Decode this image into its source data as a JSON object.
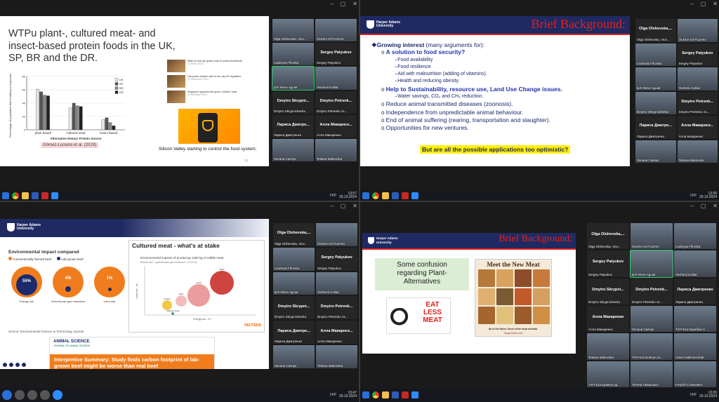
{
  "q1": {
    "slide_title": "WTPu plant-, cultured meat- and insect-based protein foods in the UK, SP, BR and the DR.",
    "chart_ylabel": "Percentage of population that is willing to buy/consume",
    "chart_xlabel": "Alternative Dietary Protein Source",
    "citation": "Gómez-Luciano et al. (2019)",
    "caption": "Silicon Valley starting to control the food system;",
    "page": "13",
    "news": [
      {
        "t": "Rally for how lab grown meat to protect livelihoods",
        "d": "14 March 2023"
      },
      {
        "t": "Lab grown chicken safe to eat, say US regulators",
        "d": "17 November 2022"
      },
      {
        "t": "Singapore approves lab grown 'chicken' meat",
        "d": "2 December 2020"
      }
    ],
    "chart_data": {
      "type": "bar",
      "categories": [
        "plant based",
        "cultured meat",
        "insect based"
      ],
      "series": [
        {
          "name": "UK",
          "values": [
            61,
            33,
            15
          ]
        },
        {
          "name": "SP",
          "values": [
            57,
            40,
            18
          ]
        },
        {
          "name": "BR",
          "values": [
            52,
            36,
            11
          ]
        },
        {
          "name": "DR",
          "values": [
            51,
            35,
            6
          ]
        }
      ],
      "ylim": [
        0,
        80
      ],
      "yticks": [
        "0",
        "20",
        "40",
        "60",
        "80"
      ]
    },
    "participants": [
      {
        "name": "Olga Olshevska, Vice...",
        "active": false
      },
      {
        "name": "OLENA KOTUZAKI",
        "active": false
      },
      {
        "name": "Liudmyla Fifurska",
        "active": false
      },
      {
        "name": "Sergey Patyukov",
        "active": false,
        "big": "Sergey Patyukov"
      },
      {
        "name": "Ijeh Kleve Aguiar",
        "active": true
      },
      {
        "name": "Yevhenii Kotliar",
        "active": false
      },
      {
        "name": "Dmytro Skrypnichenko",
        "active": false,
        "big": "Dmytro Skrypni..."
      },
      {
        "name": "Dmytro Petrenko 41...",
        "active": false,
        "big": "Dmytro Petrenk..."
      },
      {
        "name": "Лариса Дмитренко",
        "active": false,
        "big": "Лариса Дмитре..."
      },
      {
        "name": "Алла Макаренко",
        "active": false,
        "big": "Алла Макарнск..."
      },
      {
        "name": "Оксана Савчук",
        "active": false
      },
      {
        "name": "Tetiana Makovska",
        "active": false
      }
    ],
    "time": "13:57",
    "date": "29.10.2024",
    "lang": "УКР"
  },
  "q2": {
    "title": "Brief Background:",
    "uni": "Harper Adams University",
    "bullets": [
      {
        "lvl": 0,
        "text": "❖Growing interest",
        "rest": " (many arguments for):",
        "bold": true,
        "color": "#1b2a6b"
      },
      {
        "lvl": 1,
        "text": "A solution to food security?",
        "bold": true,
        "color": "#2233aa"
      },
      {
        "lvl": 2,
        "text": "Food availability"
      },
      {
        "lvl": 2,
        "text": "Food resilience"
      },
      {
        "lvl": 2,
        "text": "Aid with malnutrition (adding of vitamins)."
      },
      {
        "lvl": 2,
        "text": "Health and reducing obesity."
      },
      {
        "lvl": 1,
        "text": "Help to Sustainability, resource use, Land Use Change issues.",
        "bold": true,
        "color": "#2233aa"
      },
      {
        "lvl": 2,
        "text": "Water savings,  CO₂ and CH₄ reduction."
      },
      {
        "lvl": 1,
        "text": "Reduce animal transmitted diseases (zoonosis)."
      },
      {
        "lvl": 1,
        "text": "Independence from unpredictable animal behaviour."
      },
      {
        "lvl": 1,
        "text": "End of animal suffering (rearing, transportation and slaughter).",
        "boldpart": "End of animal suffering"
      },
      {
        "lvl": 1,
        "text": "Opportunities for new ventures."
      }
    ],
    "highlight": "But are all the possible applications too optimistic?",
    "participants": [
      {
        "name": "Olga Olshevska, Vice...",
        "big": "Olga Olshevska,..."
      },
      {
        "name": "OLENA KOTUZAKI"
      },
      {
        "name": "Liudmyla Fifurska"
      },
      {
        "name": "Sergey Patyukov",
        "big": "Sergey Patyukov"
      },
      {
        "name": "Ijeh Kleve Aguiar"
      },
      {
        "name": "Yevhenii Kotliar"
      },
      {
        "name": "Dmytro Skrypnichenko"
      },
      {
        "name": "Dmytro Petrenko 41...",
        "big": "Dmytro Petrenk..."
      },
      {
        "name": "Лариса Дмитренко",
        "big": "Лариса Дмитре..."
      },
      {
        "name": "Алла Макаренко",
        "big": "Алла Макарнск..."
      },
      {
        "name": "Оксана Савчук"
      },
      {
        "name": "Tetiana Makovska"
      }
    ],
    "time": "13:26",
    "date": "29.10.2024",
    "lang": "УКР"
  },
  "q3": {
    "uni": "Harper Adams University",
    "env_title": "Environmental impact compared",
    "legend": [
      "Conventionally farmed beef",
      "Lab-grown beef"
    ],
    "circles": [
      {
        "pct": "55%",
        "label": "Energy use"
      },
      {
        "pct": "4%",
        "label": "Greenhouse gas emissions"
      },
      {
        "pct": "1%",
        "label": "Land use"
      }
    ],
    "source": "Source: Environmental Science & Technology Journal",
    "cm_title": "Cultured meat - what's at stake",
    "cm_sub": "Environmental impacts of producing 1000 kg of edible meat",
    "cm_note": "Bubble size = greenhouse gas emissions, t CO2 eq.",
    "cm_xlabel": "Energy use - GJ",
    "cm_ylabel": "Land use - ha",
    "reuters": "REUTERS",
    "bubbles": [
      "Poultry",
      "Pork",
      "Lamb",
      "Beef",
      "Cultured meat"
    ],
    "journal": "ANIMAL SCIENCE",
    "journal_sub": "JOURNAL OF ANIMAL SCIENCE",
    "headline": "Interpretive Summary: Study finds carbon footprint of lab-grown beef might be worse than real beef",
    "participants": [
      {
        "name": "Olga Olshevska, Vice...",
        "big": "Olga Olshevska,..."
      },
      {
        "name": "OLENA KOTUZAKI"
      },
      {
        "name": "Liudmyla Fifurska"
      },
      {
        "name": "Sergey Patyukov",
        "big": "Sergey Patyukov"
      },
      {
        "name": "Ijeh Kleve Aguiar"
      },
      {
        "name": "Yevhenii Kotliar"
      },
      {
        "name": "Dmytro Skrypnichenko",
        "big": "Dmytro Skrypni..."
      },
      {
        "name": "Dmytro Petrenko 41...",
        "big": "Dmytro Petrenk..."
      },
      {
        "name": "Лариса Дмитренко",
        "big": "Лариса Дмитре..."
      },
      {
        "name": "Алла Макаренко",
        "big": "Алла Макарнск..."
      },
      {
        "name": "Оксана Савчук"
      },
      {
        "name": "Tetiana Makovska"
      }
    ],
    "time": "13:47",
    "date": "29.10.2024",
    "lang": "УКР"
  },
  "q4": {
    "uni": "Harper Adams University",
    "title": "Brief Background:",
    "confusion": "Some confusion regarding Plant-Alternatives",
    "eat": "EAT LESS MEAT",
    "meet": "Meet the New Meat",
    "meet_foot": "All of the flavor. None of the dead animals.",
    "vegan": "VeganStreet.com",
    "participants": [
      {
        "name": "Olga Olshevska, Vice...",
        "big": "Olga Olshevska,..."
      },
      {
        "name": "OLENA KOTUZAKI"
      },
      {
        "name": "Liudmyla Fifurska"
      },
      {
        "name": "Sergey Patyukov",
        "big": "Sergey Patyukov"
      },
      {
        "name": "Ijeh Kleve Aguiar",
        "active": true
      },
      {
        "name": "Yevhenii Kotliar"
      },
      {
        "name": "Dmytro Skrypnichenko",
        "big": "Dmytro Skrypni..."
      },
      {
        "name": "Dmytro Petrenko 41...",
        "big": "Dmytro Petrenk..."
      },
      {
        "name": "Лариса Дмитренко",
        "big": "Лариса Дмитренко"
      },
      {
        "name": "Алла Макаренко",
        "big": "Алла Макаренко"
      },
      {
        "name": "Оксана Савчук"
      },
      {
        "name": "ТХП-51а Карабіна С..."
      },
      {
        "name": "Tetiana Makovska"
      },
      {
        "name": "ТХП-51а Бойчук Ан..."
      },
      {
        "name": "Artem Nakhzevchak"
      },
      {
        "name": "ТХП-51а Кравчук Ді..."
      },
      {
        "name": "Тетяна Павлюшко"
      },
      {
        "name": "Георгій Станкевич"
      }
    ],
    "time": "13:26",
    "date": "29.10.2024",
    "lang": "УКР"
  },
  "colors": {
    "uk": "#e7e7e7",
    "sp": "#555555",
    "br": "#888888",
    "dr": "#222222",
    "red": "#e2211c",
    "navy": "#1b2a6b",
    "hau_blue": "#1f2a63",
    "orange": "#f07d1d"
  }
}
